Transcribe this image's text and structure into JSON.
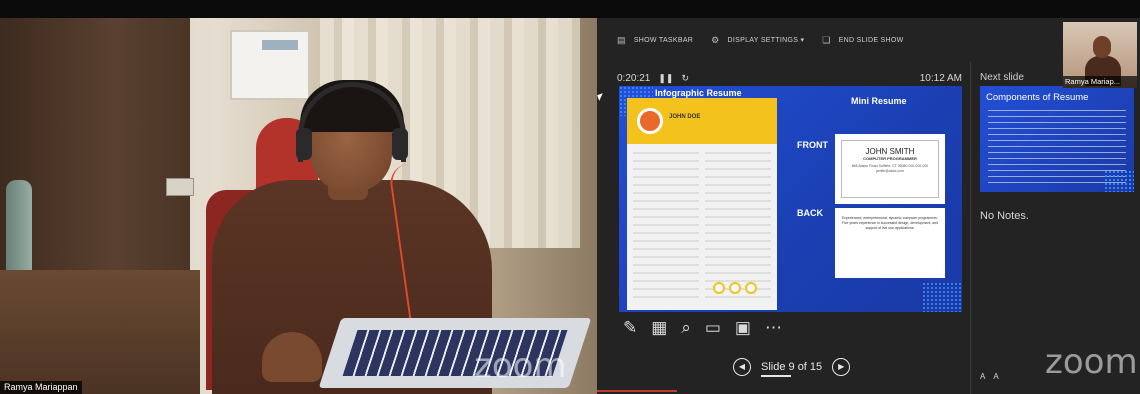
{
  "webcam": {
    "participant_name": "Ramya Mariappan",
    "watermark": "zoom"
  },
  "presenter": {
    "toolbar": {
      "show_taskbar": "SHOW TASKBAR",
      "display_settings": "DISPLAY SETTINGS ▾",
      "end_slide_show": "END SLIDE SHOW"
    },
    "timer": "0:20:21",
    "pause_icon": "❚❚",
    "reset_icon": "↻",
    "clock": "10:12 AM",
    "next_slide_label": "Next slide",
    "current_slide": {
      "title_left": "Infographic Resume",
      "title_right": "Mini Resume",
      "resume_name": "JOHN DOE",
      "front_label": "FRONT",
      "back_label": "BACK",
      "card_name": "JOHN SMITH",
      "card_role": "COMPUTER PROGRAMMER",
      "card_addr": "868 Alamo Road Suffield, CT 06080 000-000-000 jsmith@abcd.com",
      "card_back_text": "Experienced, entrepreneurial, dynamic computer programmer. Five years experience in successful design, development, and support of live use applications."
    },
    "next_slide": {
      "title": "Components of Resume"
    },
    "thumbnail_name": "Ramya Mariap...",
    "notes": "No Notes.",
    "slide_counter": "Slide 9 of 15",
    "font_increase": "A",
    "font_decrease": "A",
    "watermark": "zoom"
  }
}
